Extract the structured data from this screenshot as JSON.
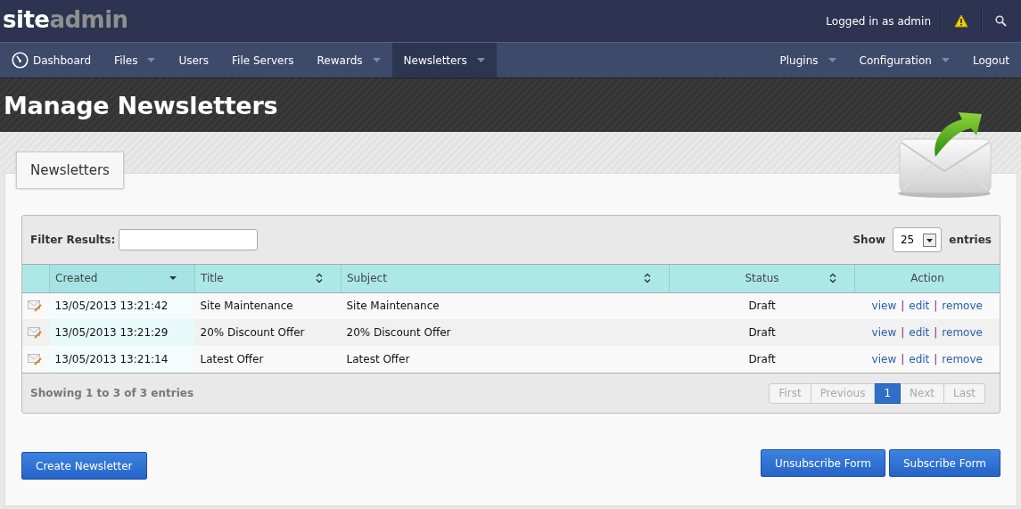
{
  "brand": {
    "part_1": "site",
    "part_2": "admin"
  },
  "top_bar": {
    "login_text": "Logged in as admin"
  },
  "nav": {
    "left": [
      {
        "label": "Dashboard",
        "dropdown": false,
        "selected": false
      },
      {
        "label": "Files",
        "dropdown": true,
        "selected": false
      },
      {
        "label": "Users",
        "dropdown": false,
        "selected": false
      },
      {
        "label": "File Servers",
        "dropdown": false,
        "selected": false
      },
      {
        "label": "Rewards",
        "dropdown": true,
        "selected": false
      },
      {
        "label": "Newsletters",
        "dropdown": true,
        "selected": true
      }
    ],
    "right": [
      {
        "label": "Plugins",
        "dropdown": true,
        "selected": false
      },
      {
        "label": "Configuration",
        "dropdown": true,
        "selected": false
      },
      {
        "label": "Logout",
        "dropdown": false,
        "selected": false
      }
    ]
  },
  "page_title": "Manage Newsletters",
  "tab": "Newsletters",
  "filter": {
    "label": "Filter Results:"
  },
  "length": {
    "label_before": "Show",
    "value": "25",
    "label_after": "entries"
  },
  "table": {
    "action_separator": "|",
    "columns": [
      {
        "sortable": false
      },
      {
        "label": "Created",
        "sortable": true,
        "sorted": true
      },
      {
        "label": "Title",
        "sortable": true,
        "sorted": false
      },
      {
        "label": "Subject",
        "sortable": true,
        "sorted": false
      },
      {
        "label": "Status",
        "sortable": true,
        "sorted": false
      },
      {
        "label": "Action",
        "sortable": false
      }
    ],
    "rows": [
      {
        "created": "13/05/2013 13:21:42",
        "title": "Site Maintenance",
        "subject": "Site Maintenance",
        "status": "Draft",
        "actions": [
          "view",
          "edit",
          "remove"
        ]
      },
      {
        "created": "13/05/2013 13:21:29",
        "title": "20% Discount Offer",
        "subject": "20% Discount Offer",
        "status": "Draft",
        "actions": [
          "view",
          "edit",
          "remove"
        ]
      },
      {
        "created": "13/05/2013 13:21:14",
        "title": "Latest Offer",
        "subject": "Latest Offer",
        "status": "Draft",
        "actions": [
          "view",
          "edit",
          "remove"
        ]
      }
    ]
  },
  "info": "Showing 1 to 3 of 3 entries",
  "pagination": [
    {
      "label": "First",
      "selected": false,
      "disabled": true
    },
    {
      "label": "Previous",
      "selected": false,
      "disabled": true
    },
    {
      "label": "1",
      "selected": true,
      "disabled": false
    },
    {
      "label": "Next",
      "selected": false,
      "disabled": true
    },
    {
      "label": "Last",
      "selected": false,
      "disabled": true
    }
  ],
  "buttons_left": [
    "Create Newsletter"
  ],
  "buttons_right": [
    "Unsubscribe Form",
    "Subscribe Form"
  ]
}
